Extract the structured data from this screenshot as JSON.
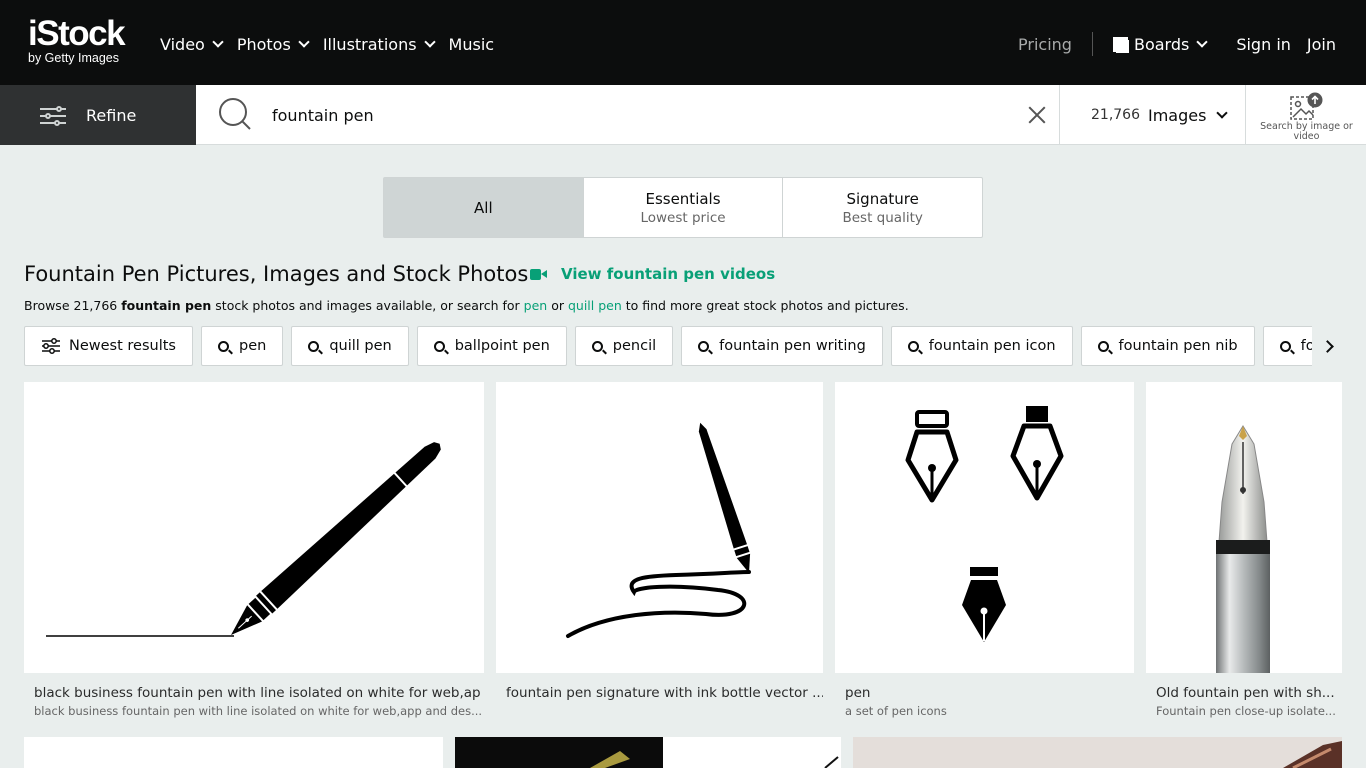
{
  "header": {
    "logo_brand": "iStock",
    "logo_sub": "by Getty Images",
    "nav": [
      "Video",
      "Photos",
      "Illustrations",
      "Music"
    ],
    "pricing": "Pricing",
    "boards": "Boards",
    "sign_in": "Sign in",
    "join": "Join"
  },
  "search": {
    "refine_label": "Refine",
    "query": "fountain pen",
    "result_count": "21,766",
    "asset_type": "Images",
    "image_search_label": "Search by image or video"
  },
  "tiers": [
    {
      "label": "All",
      "sub": ""
    },
    {
      "label": "Essentials",
      "sub": "Lowest price"
    },
    {
      "label": "Signature",
      "sub": "Best quality"
    }
  ],
  "page": {
    "title": "Fountain Pen Pictures, Images and Stock Photos",
    "video_link": "View fountain pen videos",
    "browse_pre": "Browse 21,766 ",
    "browse_bold": "fountain pen",
    "browse_mid": " stock photos and images available, or search for ",
    "browse_link1": "pen",
    "browse_or": " or ",
    "browse_link2": "quill pen",
    "browse_post": " to find more great stock photos and pictures."
  },
  "chips": {
    "sort": "Newest results",
    "related": [
      "pen",
      "quill pen",
      "ballpoint pen",
      "pencil",
      "fountain pen writing",
      "fountain pen icon",
      "fountain pen nib",
      "fountain pen"
    ]
  },
  "results": [
    {
      "title": "black business fountain pen with line isolated on white for web,ap",
      "desc": "black business fountain pen with line isolated on white for web,app and des..."
    },
    {
      "title": "fountain pen signature with ink bottle vector ...",
      "desc": ""
    },
    {
      "title": "pen",
      "desc": "a set of pen icons"
    },
    {
      "title": "Old fountain pen with sh...",
      "desc": "Fountain pen close-up isolate..."
    }
  ]
}
